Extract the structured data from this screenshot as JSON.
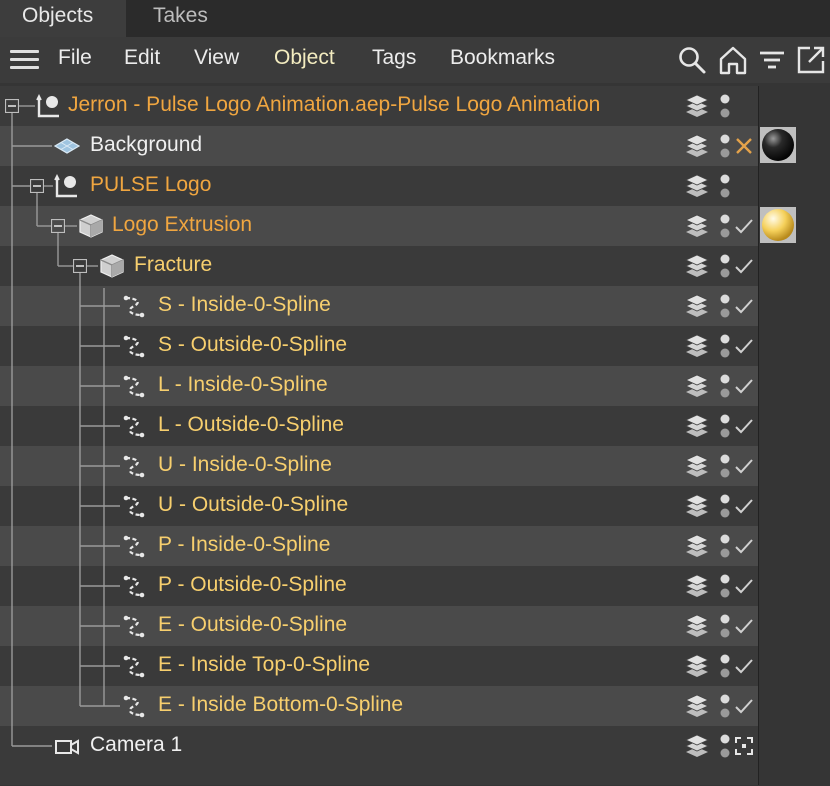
{
  "tabs": [
    {
      "label": "Objects",
      "active": true
    },
    {
      "label": "Takes",
      "active": false
    }
  ],
  "menu": {
    "items": [
      "File",
      "Edit",
      "View",
      "Object",
      "Tags",
      "Bookmarks"
    ],
    "highlighted": "Object"
  },
  "toolbar_icons": [
    "search-icon",
    "home-icon",
    "filter-icon",
    "new-window-icon"
  ],
  "colors": {
    "orange_label": "#f0a640",
    "yellow_label": "#f7cf6e",
    "white_label": "#f0f0f0"
  },
  "tree": [
    {
      "label": "Jerron - Pulse Logo Animation.aep-Pulse Logo Animation",
      "icon": "null-object-icon",
      "color": "orange",
      "depth": 0,
      "expand": true,
      "status": "none"
    },
    {
      "label": "Background",
      "icon": "background-icon",
      "color": "white",
      "depth": 1,
      "expand": false,
      "status": "cross",
      "material": "dark-sphere-material"
    },
    {
      "label": "PULSE Logo",
      "icon": "null-object-icon",
      "color": "orange",
      "depth": 1,
      "expand": true,
      "status": "none"
    },
    {
      "label": "Logo Extrusion",
      "icon": "extrude-icon",
      "color": "orange",
      "depth": 2,
      "expand": true,
      "status": "check",
      "material": "yellow-sphere-material"
    },
    {
      "label": "Fracture",
      "icon": "fracture-icon",
      "color": "yellow",
      "depth": 3,
      "expand": true,
      "status": "check"
    },
    {
      "label": "S - Inside-0-Spline",
      "icon": "spline-icon",
      "color": "yellow",
      "depth": 4,
      "expand": false,
      "status": "check"
    },
    {
      "label": "S - Outside-0-Spline",
      "icon": "spline-icon",
      "color": "yellow",
      "depth": 4,
      "expand": false,
      "status": "check"
    },
    {
      "label": "L - Inside-0-Spline",
      "icon": "spline-icon",
      "color": "yellow",
      "depth": 4,
      "expand": false,
      "status": "check"
    },
    {
      "label": "L - Outside-0-Spline",
      "icon": "spline-icon",
      "color": "yellow",
      "depth": 4,
      "expand": false,
      "status": "check"
    },
    {
      "label": "U - Inside-0-Spline",
      "icon": "spline-icon",
      "color": "yellow",
      "depth": 4,
      "expand": false,
      "status": "check"
    },
    {
      "label": "U - Outside-0-Spline",
      "icon": "spline-icon",
      "color": "yellow",
      "depth": 4,
      "expand": false,
      "status": "check"
    },
    {
      "label": "P - Inside-0-Spline",
      "icon": "spline-icon",
      "color": "yellow",
      "depth": 4,
      "expand": false,
      "status": "check"
    },
    {
      "label": "P - Outside-0-Spline",
      "icon": "spline-icon",
      "color": "yellow",
      "depth": 4,
      "expand": false,
      "status": "check"
    },
    {
      "label": "E - Outside-0-Spline",
      "icon": "spline-icon",
      "color": "yellow",
      "depth": 4,
      "expand": false,
      "status": "check"
    },
    {
      "label": "E - Inside Top-0-Spline",
      "icon": "spline-icon",
      "color": "yellow",
      "depth": 4,
      "expand": false,
      "status": "check"
    },
    {
      "label": "E - Inside Bottom-0-Spline",
      "icon": "spline-icon",
      "color": "yellow",
      "depth": 4,
      "expand": false,
      "status": "check"
    },
    {
      "label": "Camera 1",
      "icon": "camera-icon",
      "color": "white",
      "depth": 1,
      "expand": false,
      "status": "camera-target"
    }
  ]
}
